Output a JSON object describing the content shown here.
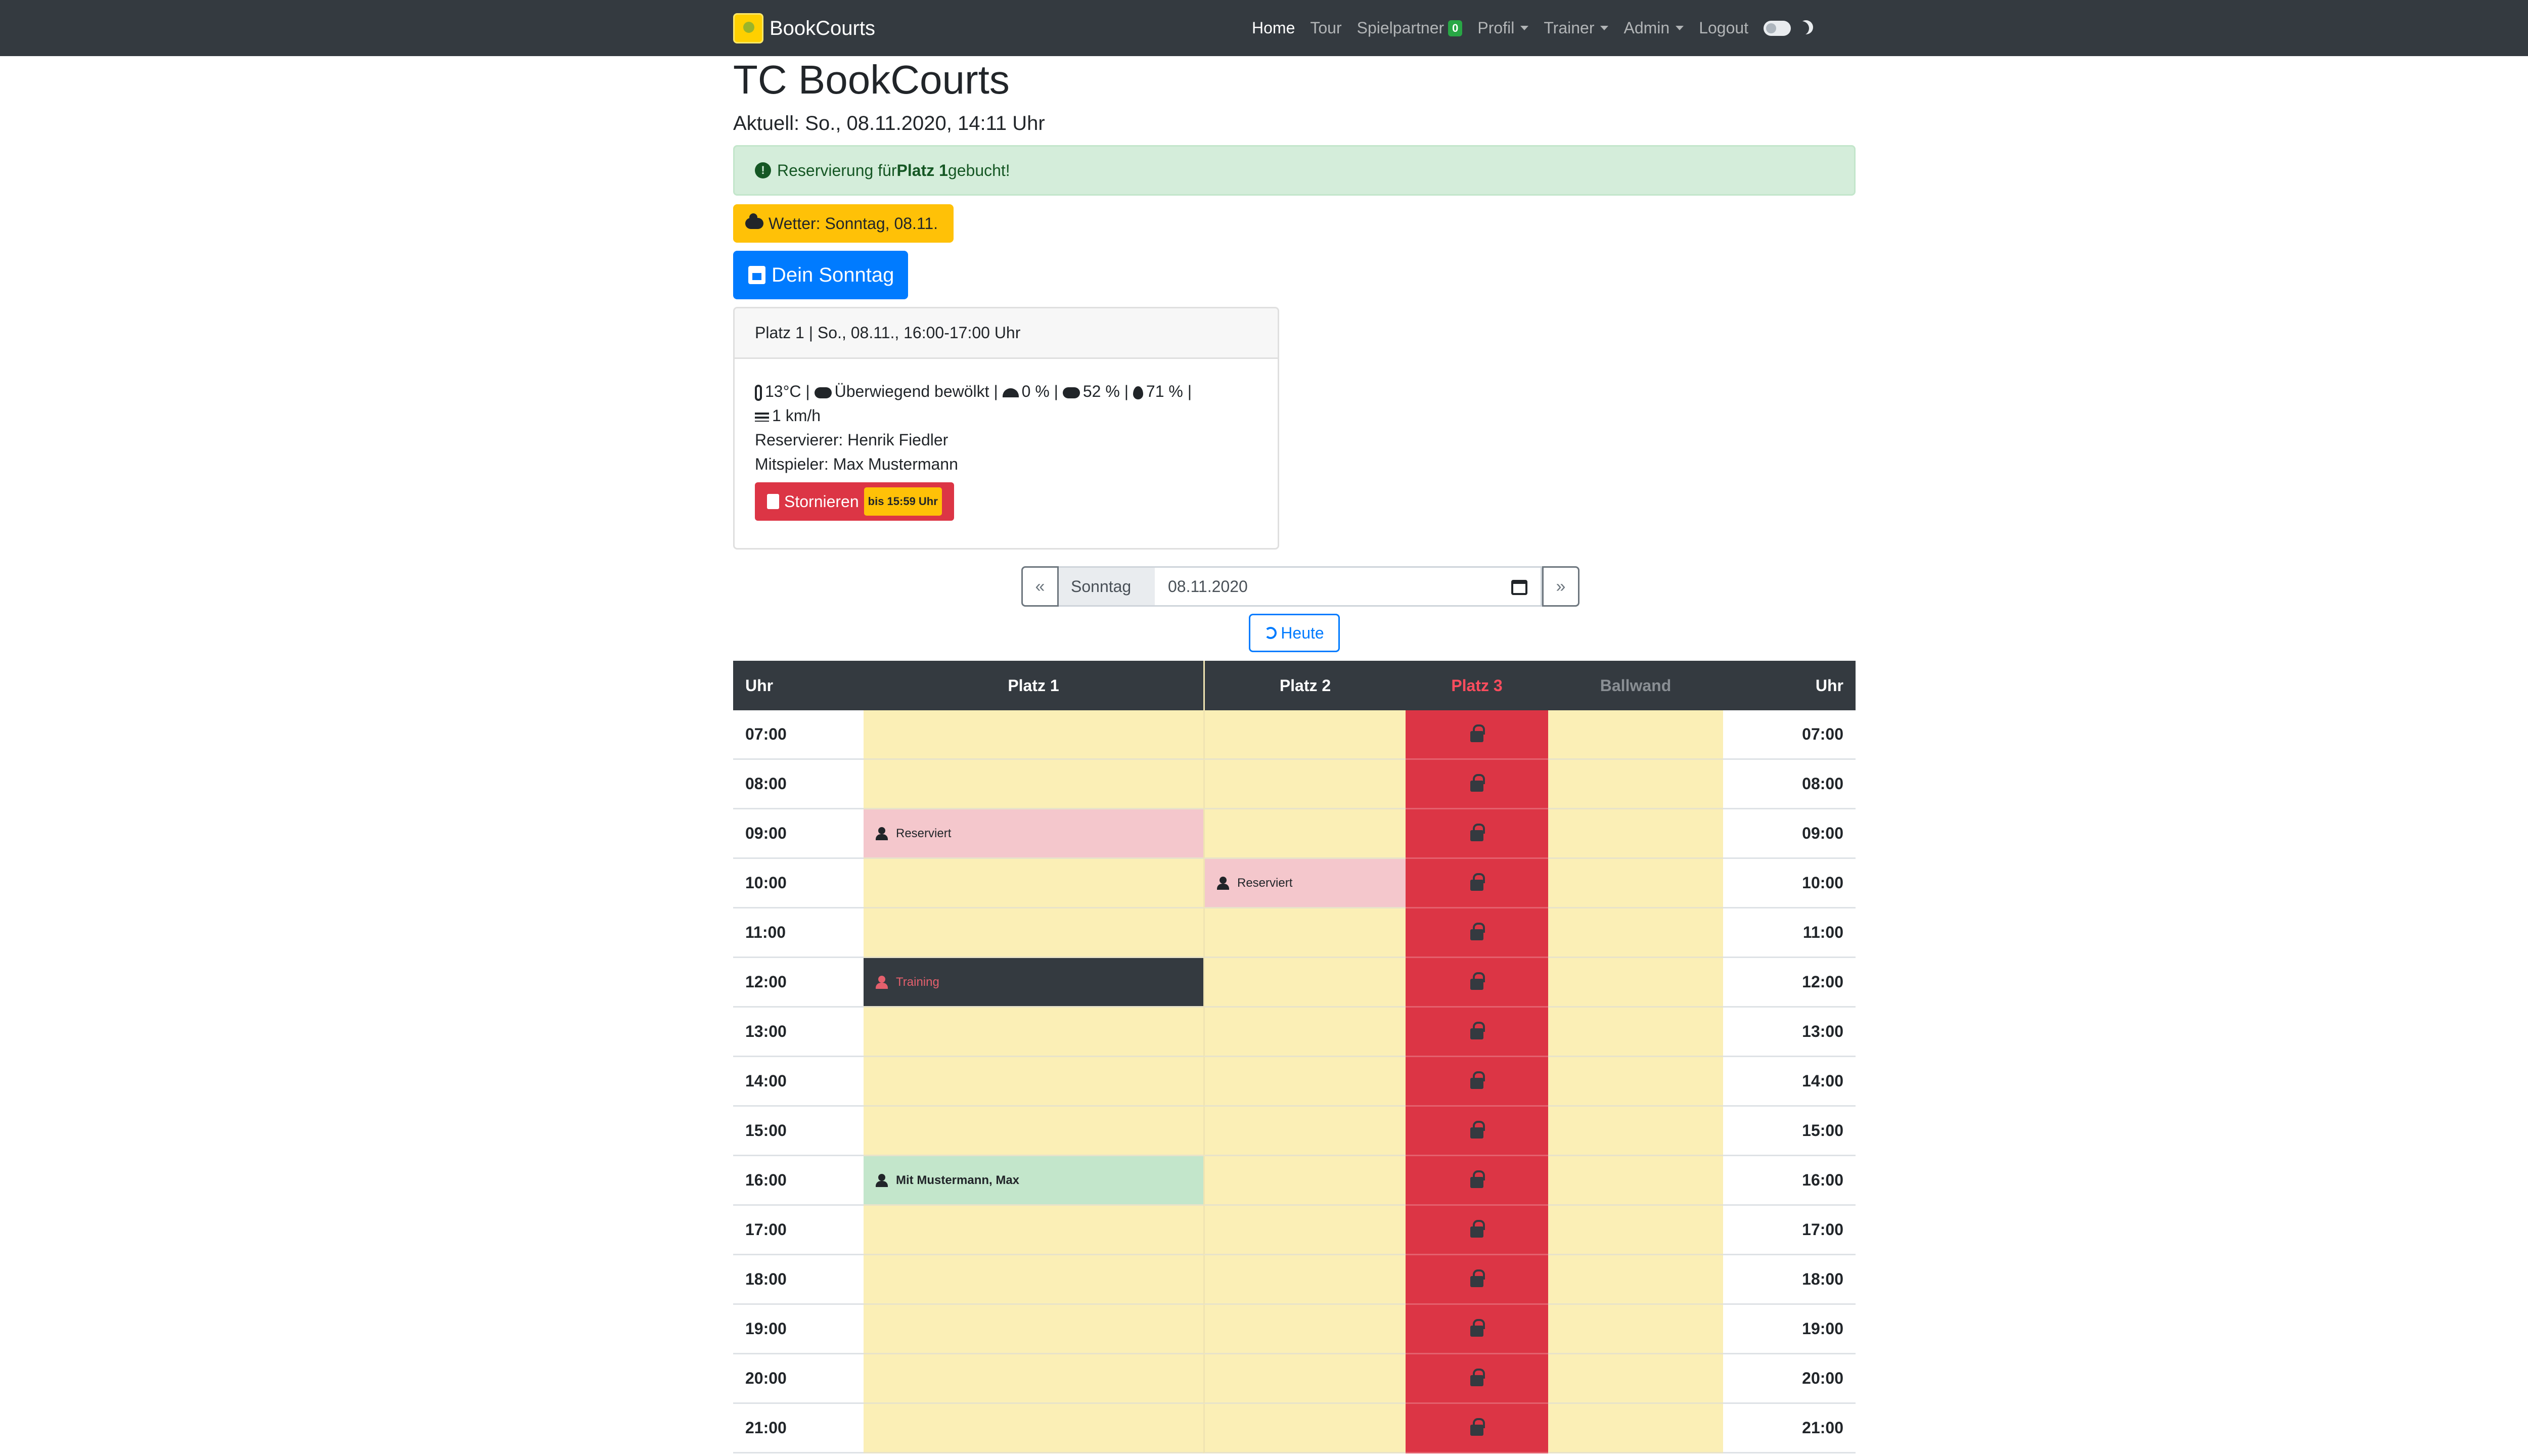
{
  "navbar": {
    "brand": "BookCourts",
    "items": [
      {
        "label": "Home",
        "active": true
      },
      {
        "label": "Tour"
      },
      {
        "label": "Spielpartner",
        "badge": "0"
      },
      {
        "label": "Profil",
        "dropdown": true
      },
      {
        "label": "Trainer",
        "dropdown": true
      },
      {
        "label": "Admin",
        "dropdown": true
      },
      {
        "label": "Logout"
      }
    ]
  },
  "header": {
    "title": "TC BookCourts",
    "subtitle": "Aktuell: So., 08.11.2020, 14:11 Uhr"
  },
  "alert": {
    "pre": "Reservierung für ",
    "court": "Platz 1",
    "post": " gebucht!"
  },
  "weather_button": "Wetter: Sonntag, 08.11.",
  "day_button": "Dein Sonntag",
  "booking_card": {
    "header": "Platz 1 | So., 08.11., 16:00-17:00 Uhr",
    "temp": "13°C",
    "condition": "Überwiegend bewölkt",
    "rain_chance": "0 %",
    "clouds": "52 %",
    "humidity": "71 %",
    "wind": "1 km/h",
    "sep": " | ",
    "reserver": "Reservierer: Henrik Fiedler",
    "coplayer": "Mitspieler: Max Mustermann",
    "cancel_label": "Stornieren",
    "cancel_badge": "bis 15:59 Uhr"
  },
  "date_nav": {
    "prev": "«",
    "next": "»",
    "day": "Sonntag",
    "date": "08.11.2020",
    "today": "Heute"
  },
  "schedule": {
    "headers": [
      "Uhr",
      "Platz 1",
      "Platz 2",
      "Platz 3",
      "Ballwand",
      "Uhr"
    ],
    "rows": [
      {
        "time": "07:00",
        "p1": "",
        "p2": ""
      },
      {
        "time": "08:00",
        "p1": "",
        "p2": ""
      },
      {
        "time": "09:00",
        "p1": "Reserviert",
        "p2": ""
      },
      {
        "time": "10:00",
        "p1": "",
        "p2": "Reserviert"
      },
      {
        "time": "11:00",
        "p1": "",
        "p2": ""
      },
      {
        "time": "12:00",
        "p1": "Training",
        "p2": ""
      },
      {
        "time": "13:00",
        "p1": "",
        "p2": ""
      },
      {
        "time": "14:00",
        "p1": "",
        "p2": ""
      },
      {
        "time": "15:00",
        "p1": "",
        "p2": ""
      },
      {
        "time": "16:00",
        "p1": "Mit Mustermann, Max",
        "p2": ""
      },
      {
        "time": "17:00",
        "p1": "",
        "p2": ""
      },
      {
        "time": "18:00",
        "p1": "",
        "p2": ""
      },
      {
        "time": "19:00",
        "p1": "",
        "p2": ""
      },
      {
        "time": "20:00",
        "p1": "",
        "p2": ""
      },
      {
        "time": "21:00",
        "p1": "",
        "p2": ""
      }
    ]
  },
  "colors": {
    "navbar": "#343a40",
    "free_slot": "#fbefb6",
    "locked_court": "#dc3545",
    "reserved": "#f4c7cc",
    "own_booking": "#c3e6cb",
    "primary": "#007bff",
    "warning": "#ffc107"
  }
}
